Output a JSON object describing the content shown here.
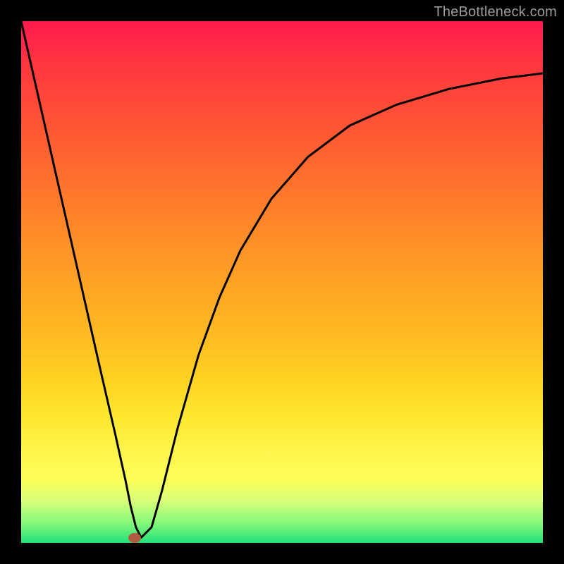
{
  "watermark": "TheBottleneck.com",
  "chart_data": {
    "type": "line",
    "title": "",
    "xlabel": "",
    "ylabel": "",
    "xrange": [
      0,
      100
    ],
    "yrange": [
      0,
      100
    ],
    "grid": false,
    "series": [
      {
        "name": "curve",
        "x": [
          0,
          5,
          10,
          15,
          18,
          20,
          21,
          22,
          23,
          25,
          27,
          30,
          34,
          38,
          42,
          48,
          55,
          63,
          72,
          82,
          92,
          100
        ],
        "y": [
          100,
          78,
          56,
          34,
          21,
          12,
          7,
          3,
          1,
          3,
          10,
          22,
          36,
          47,
          56,
          66,
          74,
          80,
          84,
          87,
          89,
          90
        ]
      }
    ],
    "marker": {
      "x": 21.8,
      "y": 1
    },
    "colors": {
      "curve": "#000000",
      "marker": "#b15a40",
      "gradient_top": "#ff1a4d",
      "gradient_bottom": "#22e07a",
      "frame": "#000000",
      "watermark": "#9b9b9b"
    }
  }
}
